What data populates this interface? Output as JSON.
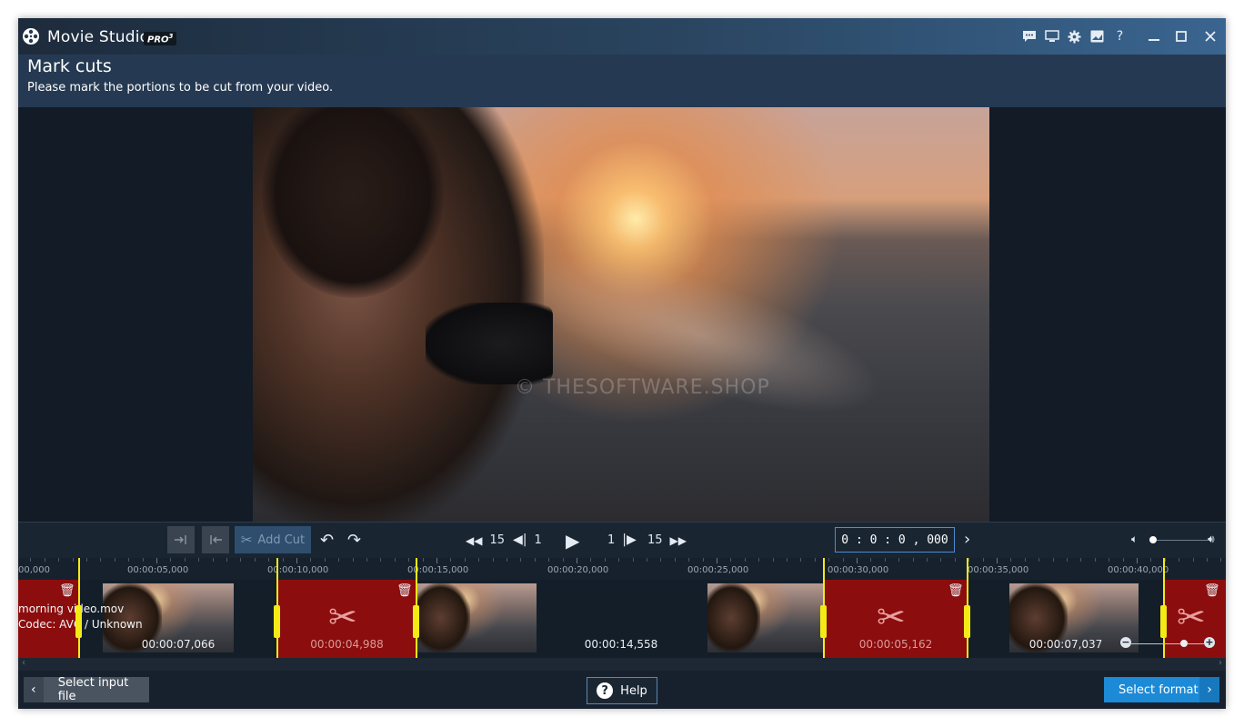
{
  "app": {
    "name": "Movie Studio",
    "badge": "PRO",
    "badge_sup": "3"
  },
  "header": {
    "title": "Mark cuts",
    "subtitle": "Please mark the portions to be cut from your video."
  },
  "video": {
    "watermark": "© THESOFTWARE.SHOP"
  },
  "controls": {
    "add_cut_label": "Add Cut",
    "skip_back_large": "15",
    "skip_back_small": "1",
    "skip_fwd_small": "1",
    "skip_fwd_large": "15",
    "timecode": "0 : 0 : 0 , 000",
    "volume_level": 0.05
  },
  "ruler": {
    "labels": [
      "00,000",
      "00:00:05,000",
      "00:00:10,000",
      "00:00:15,000",
      "00:00:20,000",
      "00:00:25,000",
      "00:00:30,000",
      "00:00:35,000",
      "00:00:40,000"
    ]
  },
  "timeline": {
    "file_name": "morning video.mov",
    "codec": "Codec: AVC / Unknown",
    "segments": [
      {
        "type": "cut",
        "duration": ""
      },
      {
        "type": "keep",
        "duration": "00:00:07,066"
      },
      {
        "type": "cut",
        "duration": "00:00:04,988"
      },
      {
        "type": "keep",
        "duration": "00:00:14,558"
      },
      {
        "type": "cut",
        "duration": "00:00:05,162"
      },
      {
        "type": "keep",
        "duration": "00:00:07,037"
      },
      {
        "type": "cut",
        "duration": ""
      }
    ]
  },
  "footer": {
    "back_label": "Select input file",
    "help_label": "Help",
    "next_label": "Select format"
  },
  "colors": {
    "cut_segment": "#8c0d0d",
    "marker": "#f4ea16",
    "primary_button": "#1c8ad6"
  }
}
